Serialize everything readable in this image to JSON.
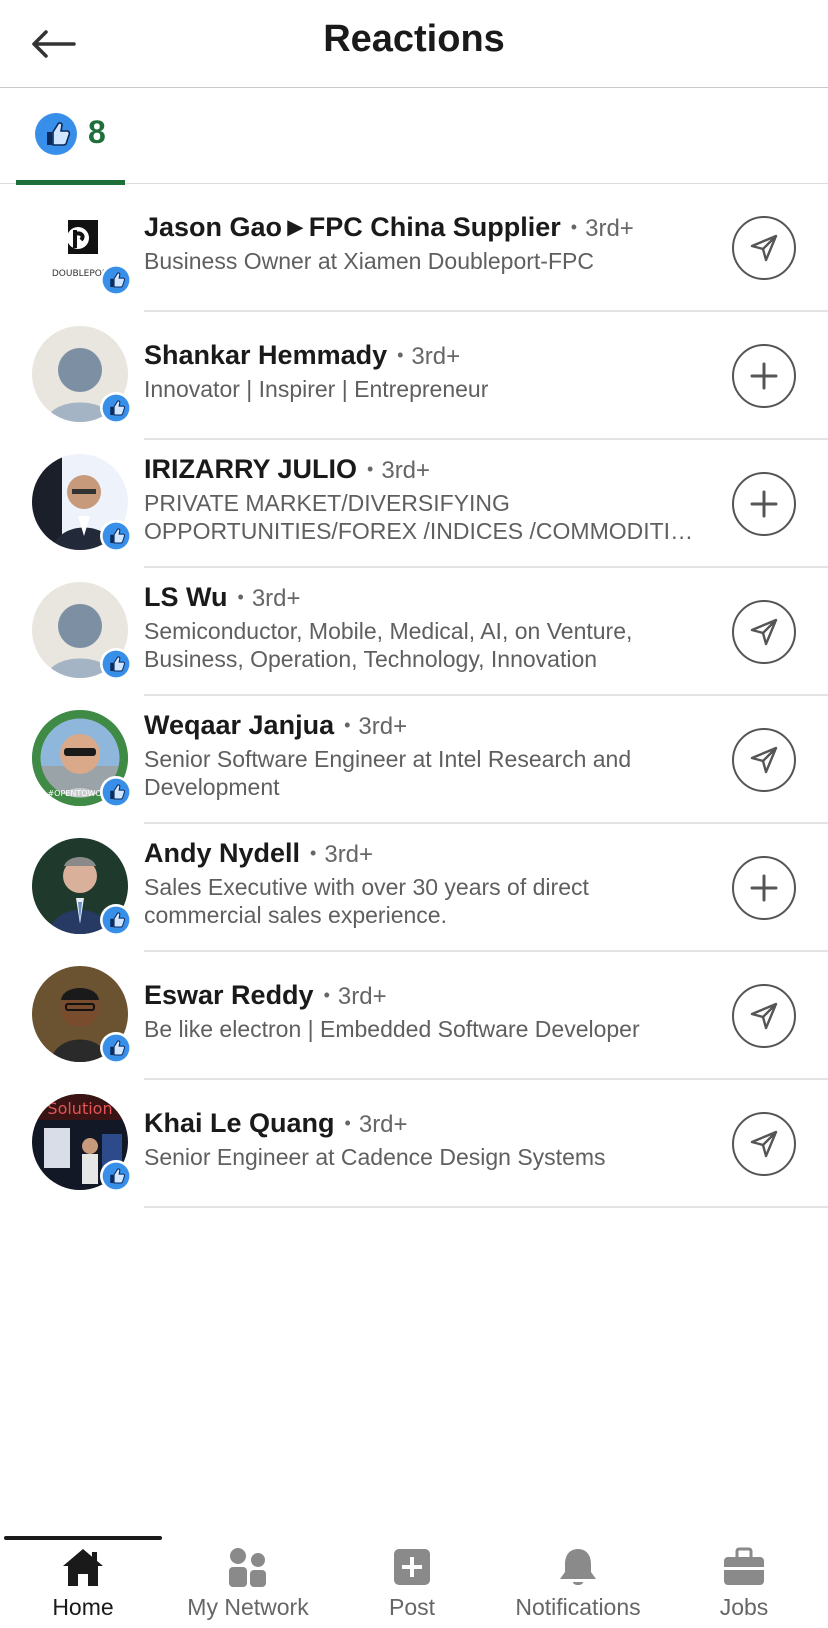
{
  "header": {
    "title": "Reactions"
  },
  "tabs": [
    {
      "icon": "like-icon",
      "count": "8"
    }
  ],
  "reactors": [
    {
      "name": "Jason Gao►FPC China Supplier",
      "degree": "3rd+",
      "headline1": "Business Owner at Xiamen Doubleport-FPC",
      "headline2": "",
      "action": "message",
      "avatar": "doubleport-logo",
      "avatar_text": "DOUBLEPOR"
    },
    {
      "name": "Shankar Hemmady",
      "degree": "3rd+",
      "headline1": "Innovator | Inspirer | Entrepreneur",
      "headline2": "",
      "action": "connect",
      "avatar": "placeholder"
    },
    {
      "name": "IRIZARRY JULIO",
      "degree": "3rd+",
      "headline1": "PRIVATE MARKET/DIVERSIFYING",
      "headline2": "OPPORTUNITIES/FOREX /INDICES /COMMODITIES",
      "action": "connect",
      "avatar": "photo"
    },
    {
      "name": "LS Wu",
      "degree": "3rd+",
      "headline1": "Semiconductor, Mobile, Medical, AI, on Venture,",
      "headline2": "Business, Operation, Technology, Innovation",
      "action": "message",
      "avatar": "placeholder"
    },
    {
      "name": "Weqaar Janjua",
      "degree": "3rd+",
      "headline1": "Senior Software Engineer at Intel Research and",
      "headline2": "Development",
      "action": "message",
      "avatar": "photo-opentowork",
      "avatar_text": "#OPENTOWORK"
    },
    {
      "name": "Andy Nydell",
      "degree": "3rd+",
      "headline1": "Sales Executive with over 30 years of direct",
      "headline2": "commercial sales experience.",
      "action": "connect",
      "avatar": "photo"
    },
    {
      "name": "Eswar Reddy",
      "degree": "3rd+",
      "headline1": "Be like electron | Embedded Software Developer",
      "headline2": "",
      "action": "message",
      "avatar": "photo"
    },
    {
      "name": "Khai Le Quang",
      "degree": "3rd+",
      "headline1": "Senior Engineer at Cadence Design Systems",
      "headline2": "",
      "action": "message",
      "avatar": "photo",
      "avatar_text": "Solution"
    }
  ],
  "bottom_nav": [
    {
      "label": "Home",
      "icon": "home-icon",
      "active": true
    },
    {
      "label": "My Network",
      "icon": "network-icon",
      "active": false
    },
    {
      "label": "Post",
      "icon": "post-icon",
      "active": false
    },
    {
      "label": "Notifications",
      "icon": "bell-icon",
      "active": false
    },
    {
      "label": "Jobs",
      "icon": "briefcase-icon",
      "active": false
    }
  ],
  "colors": {
    "accent_green": "#1f6f3b",
    "like_blue": "#378fe9",
    "divider": "#e3e3e3"
  }
}
